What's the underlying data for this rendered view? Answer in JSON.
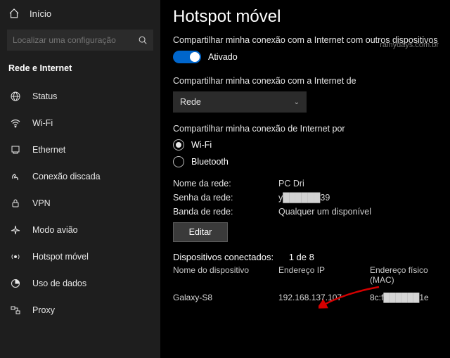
{
  "watermark": "rainydays.com.br",
  "sidebar": {
    "home": "Início",
    "search_placeholder": "Localizar uma configuração",
    "category": "Rede e Internet",
    "items": [
      {
        "label": "Status",
        "icon": "globe-icon"
      },
      {
        "label": "Wi-Fi",
        "icon": "wifi-icon"
      },
      {
        "label": "Ethernet",
        "icon": "ethernet-icon"
      },
      {
        "label": "Conexão discada",
        "icon": "dialup-icon"
      },
      {
        "label": "VPN",
        "icon": "vpn-icon"
      },
      {
        "label": "Modo avião",
        "icon": "airplane-icon"
      },
      {
        "label": "Hotspot móvel",
        "icon": "hotspot-icon"
      },
      {
        "label": "Uso de dados",
        "icon": "data-usage-icon"
      },
      {
        "label": "Proxy",
        "icon": "proxy-icon"
      }
    ]
  },
  "main": {
    "title": "Hotspot móvel",
    "share_desc": "Compartilhar minha conexão com a Internet com outros dispositivos",
    "toggle_state": "Ativado",
    "share_from_label": "Compartilhar minha conexão com a Internet de",
    "share_from_value": "Rede",
    "share_over_label": "Compartilhar minha conexão de Internet por",
    "radio_wifi": "Wi-Fi",
    "radio_bt": "Bluetooth",
    "net_name_label": "Nome da rede:",
    "net_name_value": "PC Dri",
    "net_pwd_label": "Senha da rede:",
    "net_pwd_value": "y██████39",
    "net_band_label": "Banda de rede:",
    "net_band_value": "Qualquer um disponível",
    "edit_label": "Editar",
    "connected_label": "Dispositivos conectados:",
    "connected_count": "1 de 8",
    "col_device": "Nome do dispositivo",
    "col_ip": "Endereço IP",
    "col_mac": "Endereço físico (MAC)",
    "row_device": "Galaxy-S8",
    "row_ip": "192.168.137.107",
    "row_mac": "8c:f██████1e"
  }
}
